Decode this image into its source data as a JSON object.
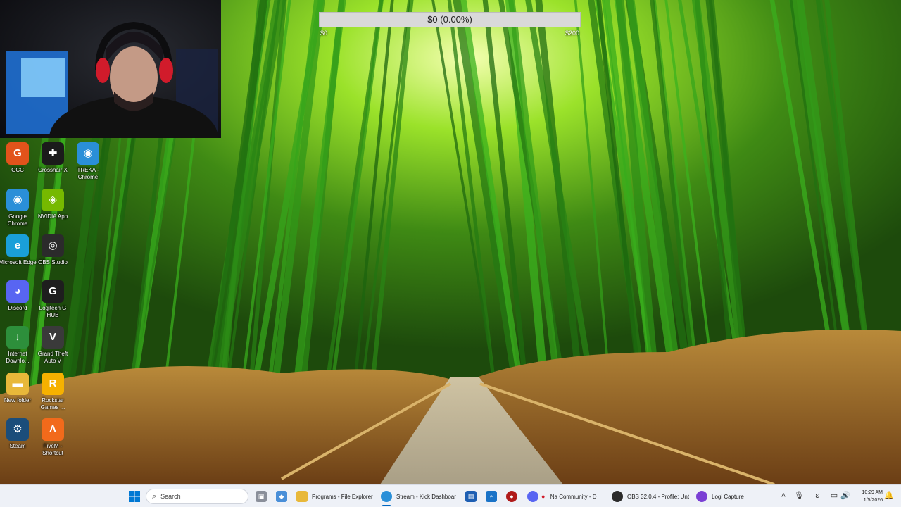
{
  "goal": {
    "text": "$0 (0.00%)",
    "min_label": "$0",
    "max_label": "$200",
    "progress_fraction": 0.0
  },
  "desktop_icons": [
    {
      "name": "gcc-icon",
      "label": "GCC",
      "color": "#e2531b",
      "glyph": "G"
    },
    {
      "name": "crosshair-x-icon",
      "label": "Crosshair X",
      "color": "#1b1b1b",
      "glyph": "✚"
    },
    {
      "name": "trek-chrome-icon",
      "label": "TREKA - Chrome",
      "color": "#2a8fd8",
      "glyph": "◉"
    },
    {
      "name": "google-chrome-icon",
      "label": "Google Chrome",
      "color": "#2a8fd8",
      "glyph": "◉"
    },
    {
      "name": "nvidia-app-icon",
      "label": "NVIDIA App",
      "color": "#76b900",
      "glyph": "◈"
    },
    {
      "name": "microsoft-edge-icon",
      "label": "Microsoft Edge",
      "color": "#1a9fd9",
      "glyph": "e"
    },
    {
      "name": "obs-studio-icon",
      "label": "OBS Studio",
      "color": "#2b2b2b",
      "glyph": "◎"
    },
    {
      "name": "discord-icon",
      "label": "Discord",
      "color": "#5865f2",
      "glyph": "◕"
    },
    {
      "name": "logitech-g-hub-icon",
      "label": "Logitech G HUB",
      "color": "#1e1e1e",
      "glyph": "G"
    },
    {
      "name": "internet-download-manager-icon",
      "label": "Internet Downlo...",
      "color": "#2d8f3b",
      "glyph": "↓"
    },
    {
      "name": "gta-v-icon",
      "label": "Grand Theft Auto V",
      "color": "#3a3a3a",
      "glyph": "V"
    },
    {
      "name": "new-folder-icon",
      "label": "New folder",
      "color": "#e8b83a",
      "glyph": "▬"
    },
    {
      "name": "rockstar-games-icon",
      "label": "Rockstar Games ...",
      "color": "#f6b100",
      "glyph": "R"
    },
    {
      "name": "steam-icon",
      "label": "Steam",
      "color": "#1b4d7a",
      "glyph": "⚙"
    },
    {
      "name": "fivem-icon",
      "label": "FiveM - Shortcut",
      "color": "#f26a1b",
      "glyph": "Λ"
    }
  ],
  "taskbar": {
    "search_placeholder": "Search",
    "apps": [
      {
        "name": "file-explorer-taskbar-item",
        "label": "Programs - File Explorer",
        "color": "#e8b83a"
      },
      {
        "name": "chrome-kick-taskbar-item",
        "label": "Stream - Kick Dashboar",
        "color": "#2a8fd8"
      },
      {
        "name": "discord-taskbar-item",
        "label": "| Na Community - D",
        "color": "#5865f2"
      },
      {
        "name": "obs-taskbar-item",
        "label": "OBS 32.0.4 - Profile: Unt",
        "color": "#2b2b2b"
      },
      {
        "name": "logi-capture-taskbar-item",
        "label": "Logi Capture",
        "color": "#7a3fd4"
      }
    ],
    "clock_time": "10:29 AM",
    "clock_date": "1/5/2026",
    "accent": "#0067c0"
  }
}
